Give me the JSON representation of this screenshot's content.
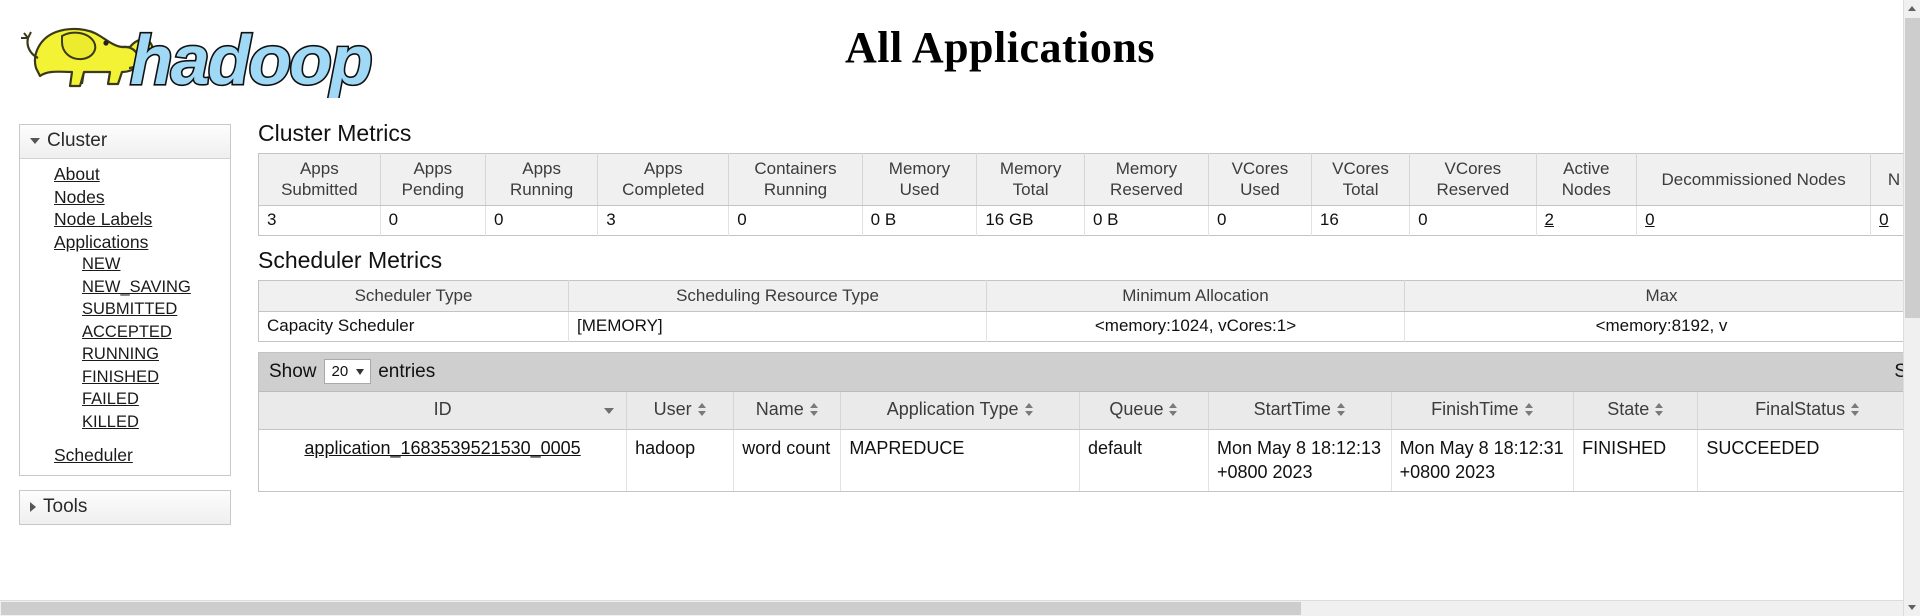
{
  "page": {
    "title": "All Applications",
    "logo_text": "hadoop"
  },
  "sidebar": {
    "cluster": {
      "label": "Cluster",
      "items": [
        {
          "label": "About"
        },
        {
          "label": "Nodes"
        },
        {
          "label": "Node Labels"
        },
        {
          "label": "Applications"
        }
      ],
      "app_states": [
        {
          "label": "NEW"
        },
        {
          "label": "NEW_SAVING"
        },
        {
          "label": "SUBMITTED"
        },
        {
          "label": "ACCEPTED"
        },
        {
          "label": "RUNNING"
        },
        {
          "label": "FINISHED"
        },
        {
          "label": "FAILED"
        },
        {
          "label": "KILLED"
        }
      ],
      "scheduler": {
        "label": "Scheduler"
      }
    },
    "tools": {
      "label": "Tools"
    }
  },
  "cluster_metrics": {
    "title": "Cluster Metrics",
    "headers": [
      "Apps Submitted",
      "Apps Pending",
      "Apps Running",
      "Apps Completed",
      "Containers Running",
      "Memory Used",
      "Memory Total",
      "Memory Reserved",
      "VCores Used",
      "VCores Total",
      "VCores Reserved",
      "Active Nodes",
      "Decommissioned Nodes",
      "N"
    ],
    "row": [
      {
        "value": "3",
        "link": false
      },
      {
        "value": "0",
        "link": false
      },
      {
        "value": "0",
        "link": false
      },
      {
        "value": "3",
        "link": false
      },
      {
        "value": "0",
        "link": false
      },
      {
        "value": "0 B",
        "link": false
      },
      {
        "value": "16 GB",
        "link": false
      },
      {
        "value": "0 B",
        "link": false
      },
      {
        "value": "0",
        "link": false
      },
      {
        "value": "16",
        "link": false
      },
      {
        "value": "0",
        "link": false
      },
      {
        "value": "2",
        "link": true
      },
      {
        "value": "0",
        "link": true
      },
      {
        "value": "0",
        "link": true
      }
    ]
  },
  "scheduler_metrics": {
    "title": "Scheduler Metrics",
    "headers": [
      "Scheduler Type",
      "Scheduling Resource Type",
      "Minimum Allocation",
      "Max"
    ],
    "row": [
      "Capacity Scheduler",
      "[MEMORY]",
      "<memory:1024, vCores:1>",
      "<memory:8192, v"
    ]
  },
  "apps_table": {
    "show_label": "Show",
    "entries_label": "entries",
    "page_size": "20",
    "search_label": "S",
    "headers": [
      {
        "label": "ID",
        "sort": "desc"
      },
      {
        "label": "User",
        "sort": "both"
      },
      {
        "label": "Name",
        "sort": "both"
      },
      {
        "label": "Application Type",
        "sort": "both"
      },
      {
        "label": "Queue",
        "sort": "both"
      },
      {
        "label": "StartTime",
        "sort": "both"
      },
      {
        "label": "FinishTime",
        "sort": "both"
      },
      {
        "label": "State",
        "sort": "both"
      },
      {
        "label": "FinalStatus",
        "sort": "both"
      }
    ],
    "rows": [
      {
        "id": "application_1683539521530_0005",
        "user": "hadoop",
        "name": "word count",
        "app_type": "MAPREDUCE",
        "queue": "default",
        "start_time": "Mon May 8 18:12:13 +0800 2023",
        "finish_time": "Mon May 8 18:12:31 +0800 2023",
        "state": "FINISHED",
        "final_status": "SUCCEEDED"
      }
    ]
  }
}
